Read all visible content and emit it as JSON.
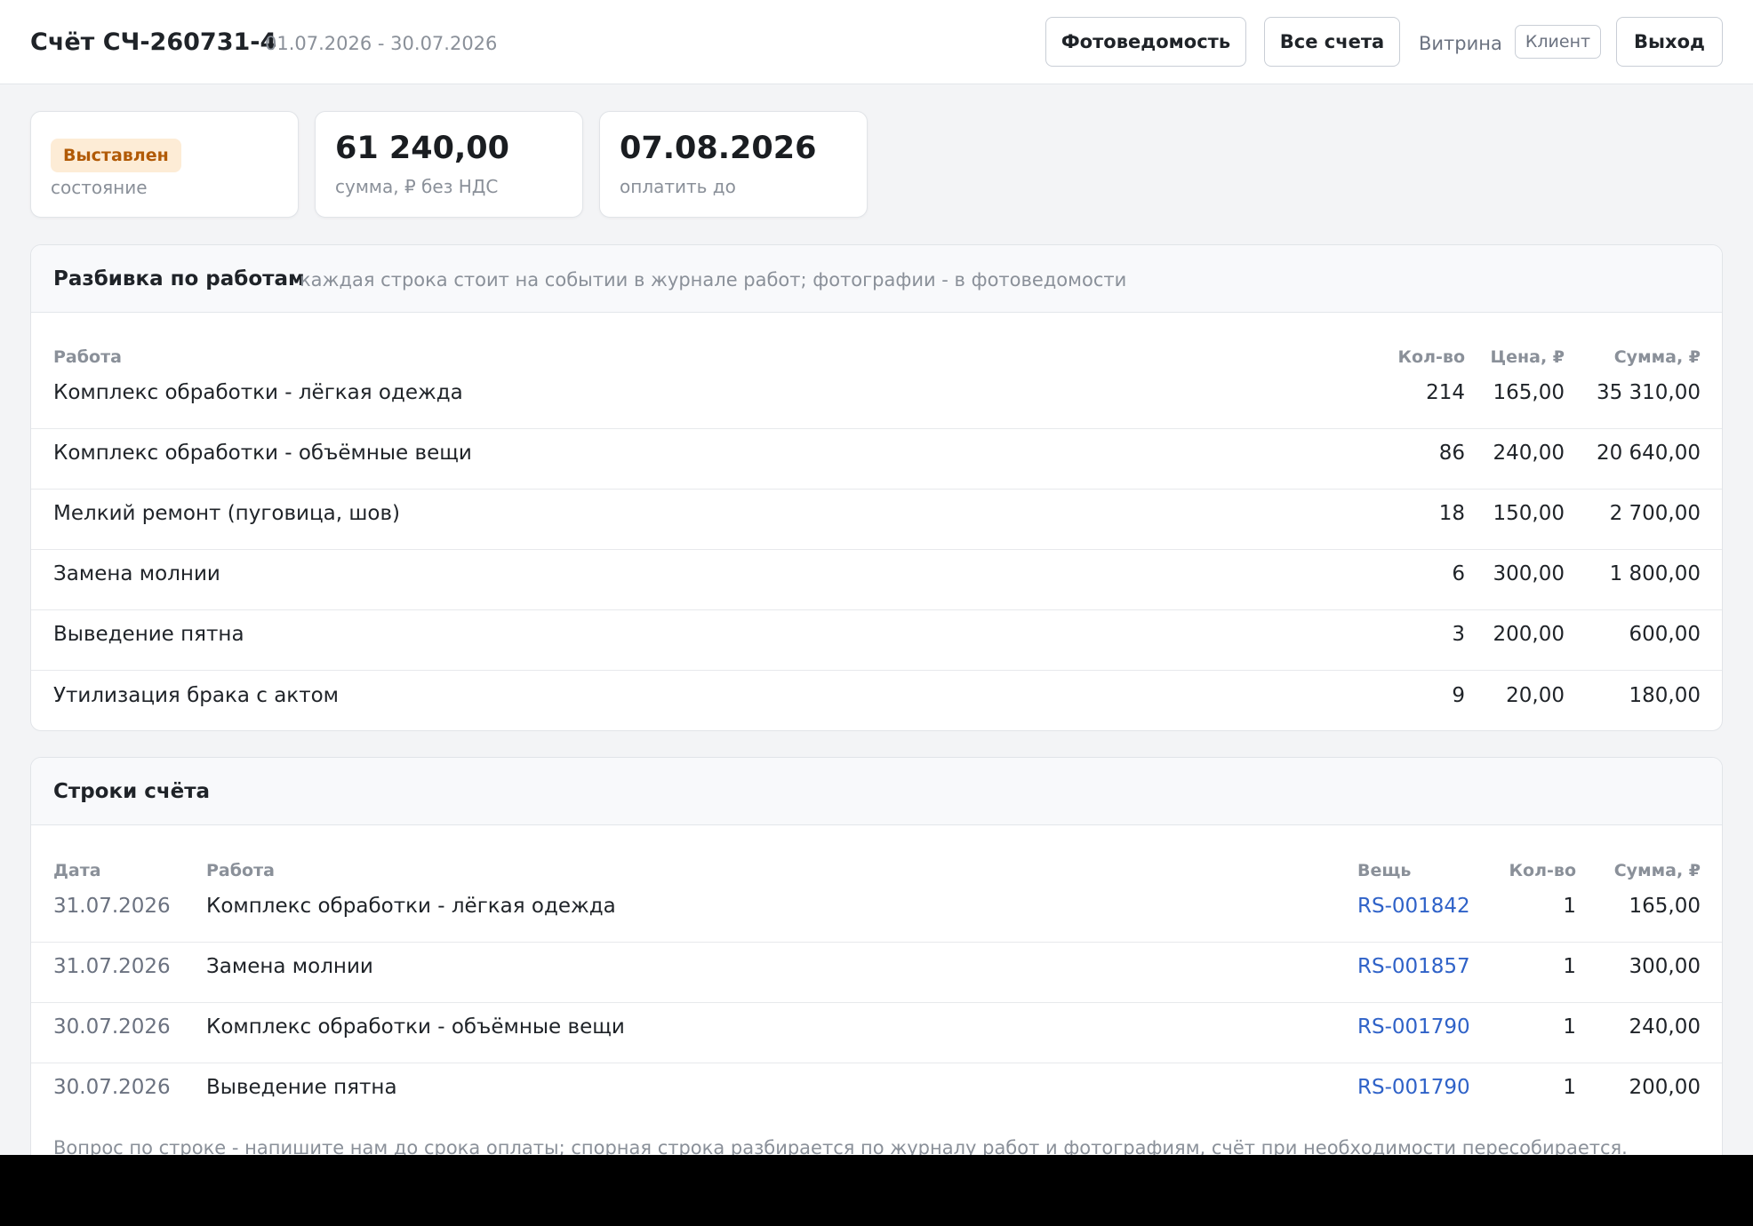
{
  "header": {
    "title": "Счёт СЧ-260731-4",
    "period": "01.07.2026 - 30.07.2026",
    "btn_photo": "Фотоведомость",
    "btn_all": "Все счета",
    "vitrina": "Витрина",
    "role": "Клиент",
    "btn_exit": "Выход"
  },
  "stats": {
    "status_badge": "Выставлен",
    "status_label": "состояние",
    "sum_value": "61 240,00",
    "sum_label": "сумма, ₽ без НДС",
    "due_value": "07.08.2026",
    "due_label": "оплатить до"
  },
  "breakdown": {
    "title": "Разбивка по работам",
    "hint": "каждая строка стоит на событии в журнале работ; фотографии - в фотоведомости",
    "columns": {
      "work": "Работа",
      "qty": "Кол-во",
      "price": "Цена, ₽",
      "sum": "Сумма, ₽"
    },
    "rows": [
      {
        "work": "Комплекс обработки - лёгкая одежда",
        "qty": "214",
        "price": "165,00",
        "sum": "35 310,00"
      },
      {
        "work": "Комплекс обработки - объёмные вещи",
        "qty": "86",
        "price": "240,00",
        "sum": "20 640,00"
      },
      {
        "work": "Мелкий ремонт (пуговица, шов)",
        "qty": "18",
        "price": "150,00",
        "sum": "2 700,00"
      },
      {
        "work": "Замена молнии",
        "qty": "6",
        "price": "300,00",
        "sum": "1 800,00"
      },
      {
        "work": "Выведение пятна",
        "qty": "3",
        "price": "200,00",
        "sum": "600,00"
      },
      {
        "work": "Утилизация брака с актом",
        "qty": "9",
        "price": "20,00",
        "sum": "180,00"
      }
    ]
  },
  "lines": {
    "title": "Строки счёта",
    "columns": {
      "date": "Дата",
      "work": "Работа",
      "item": "Вещь",
      "qty": "Кол-во",
      "sum": "Сумма, ₽"
    },
    "rows": [
      {
        "date": "31.07.2026",
        "work": "Комплекс обработки - лёгкая одежда",
        "item": "RS-001842",
        "qty": "1",
        "sum": "165,00"
      },
      {
        "date": "31.07.2026",
        "work": "Замена молнии",
        "item": "RS-001857",
        "qty": "1",
        "sum": "300,00"
      },
      {
        "date": "30.07.2026",
        "work": "Комплекс обработки - объёмные вещи",
        "item": "RS-001790",
        "qty": "1",
        "sum": "240,00"
      },
      {
        "date": "30.07.2026",
        "work": "Выведение пятна",
        "item": "RS-001790",
        "qty": "1",
        "sum": "200,00"
      }
    ],
    "footnote": "Вопрос по строке - напишите нам до срока оплаты; спорная строка разбирается по журналу работ и фотографиям, счёт при необходимости пересобирается."
  }
}
